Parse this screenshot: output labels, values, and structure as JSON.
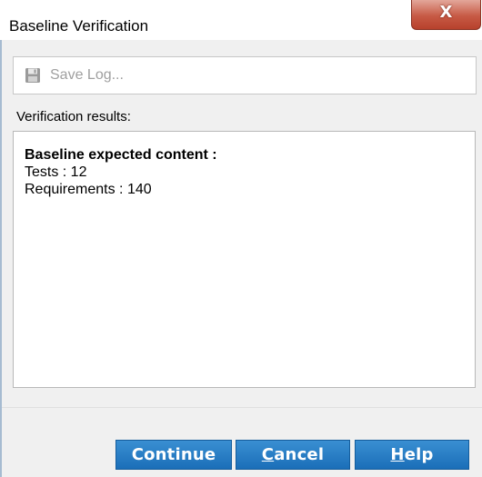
{
  "window": {
    "title": "Baseline Verification",
    "close_glyph": "X"
  },
  "toolbar": {
    "save_log_label": "Save Log...",
    "save_icon": "floppy-disk-icon"
  },
  "results": {
    "label": "Verification results:",
    "heading": "Baseline expected content :",
    "lines": [
      "Tests : 12",
      "Requirements : 140"
    ]
  },
  "buttons": {
    "continue": {
      "label": "Continue"
    },
    "cancel": {
      "first": "C",
      "rest": "ancel"
    },
    "help": {
      "first": "H",
      "rest": "elp"
    }
  },
  "colors": {
    "button_blue": "#1b6eb8",
    "close_red": "#c75a45",
    "disabled_text": "#a0a0a0"
  }
}
